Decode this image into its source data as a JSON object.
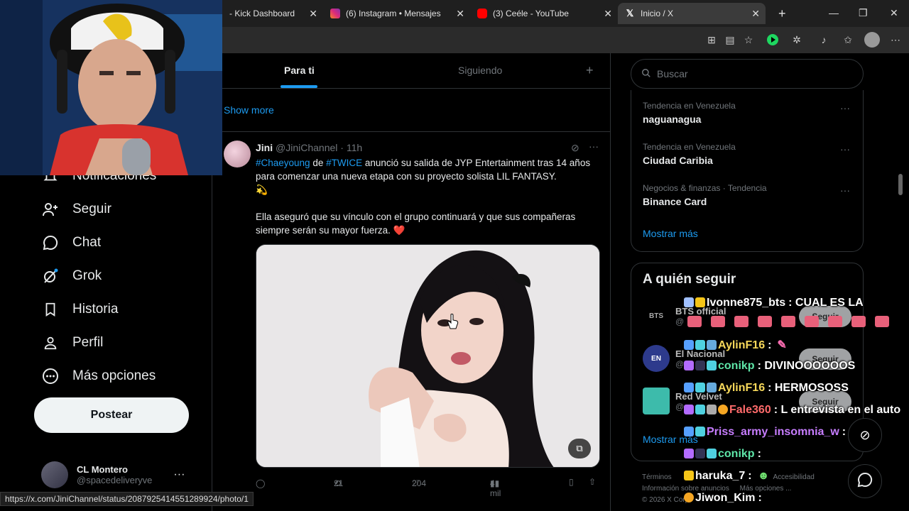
{
  "browser": {
    "tabs": [
      {
        "title": "- Kick Dashboard",
        "color": "#53fc18"
      },
      {
        "title": "(6) Instagram • Mensajes",
        "color": "#e1306c"
      },
      {
        "title": "(3) Ceéle - YouTube",
        "color": "#ff0000"
      },
      {
        "title": "Inicio / X",
        "color": "#ffffff"
      }
    ],
    "new_tab": "+",
    "status_url": "https://x.com/JiniChannel/status/2087925414551289924/photo/1"
  },
  "sidebar": {
    "items": [
      {
        "label": "Notificaciones",
        "icon": "bell-icon"
      },
      {
        "label": "Seguir",
        "icon": "person-add-icon"
      },
      {
        "label": "Chat",
        "icon": "chat-icon"
      },
      {
        "label": "Grok",
        "icon": "grok-icon"
      },
      {
        "label": "Historia",
        "icon": "bookmark-icon"
      },
      {
        "label": "Perfil",
        "icon": "person-icon"
      },
      {
        "label": "Más opciones",
        "icon": "more-circle-icon"
      }
    ],
    "post_label": "Postear",
    "profile": {
      "name": "CL Montero",
      "handle": "@spacedeliveryve",
      "more": "···"
    }
  },
  "feed": {
    "tabs": [
      "Para ti",
      "Siguiendo"
    ],
    "show_more": "Show more",
    "tweet": {
      "name": "Jini",
      "handle": "@JiniChannel",
      "time": "· 11h",
      "tag1": "#Chaeyoung",
      "de": " de ",
      "tag2": "#TWICE",
      "text1": " anunció su salida de JYP Entertainment tras 14 años para comenzar una nueva etapa con su proyecto solista LIL FANTASY.",
      "emoji1": "💫",
      "text2": "Ella aseguró que su vínculo con el grupo continuará y que sus compañeras siempre serán su mayor fuerza.",
      "emoji2": "❤️",
      "retweets": "21",
      "likes": "204",
      "views": "4 mil"
    }
  },
  "right": {
    "search_placeholder": "Buscar",
    "trends": [
      {
        "context": "Tendencia en Venezuela",
        "name": "naguanagua"
      },
      {
        "context": "Tendencia en Venezuela",
        "name": "Ciudad Caribia"
      },
      {
        "context": "Negocios & finanzas · Tendencia",
        "name": "Binance Card"
      }
    ],
    "trends_more": "Mostrar más",
    "who_title": "A quién seguir",
    "suggestions": [
      {
        "name": "BTS official",
        "handle": "@",
        "avatar": "BTS"
      },
      {
        "name": "El Nacional",
        "handle": "@",
        "avatar": "EN"
      },
      {
        "name": "Red Velvet",
        "handle": "@",
        "avatar": ""
      }
    ],
    "follow_label": "Seguir",
    "who_more": "Mostrar más",
    "footer": [
      "Términos",
      "Accesibilidad",
      "Información sobre anuncios",
      "Más opciones ...",
      "© 2026 X Corp."
    ]
  },
  "chat": [
    {
      "user": "Ivonne875_bts",
      "text": ": CUAL ES LA",
      "color": "#f0f0f0"
    },
    {
      "user": "AylinF16",
      "text": ":",
      "color": "#f5d75a"
    },
    {
      "user": "conikp",
      "text": ": DIVINOOOOOOS",
      "color": "#5ee6a8"
    },
    {
      "user": "AylinF16",
      "text": ": HERMOSOSS",
      "color": "#f5d75a"
    },
    {
      "user": "Fale360",
      "text": ": L entrevista en el auto",
      "color": "#ff6b6b"
    },
    {
      "user": "Priss_army_insomnia_w",
      "text": ":",
      "color": "#c77dff"
    },
    {
      "user": "conikp",
      "text": ":",
      "color": "#5ee6a8"
    },
    {
      "user": "haruka_7",
      "text": ":",
      "color": "#f0f0f0"
    },
    {
      "user": "Jiwon_Kim",
      "text": ":",
      "color": "#f0f0f0"
    }
  ]
}
